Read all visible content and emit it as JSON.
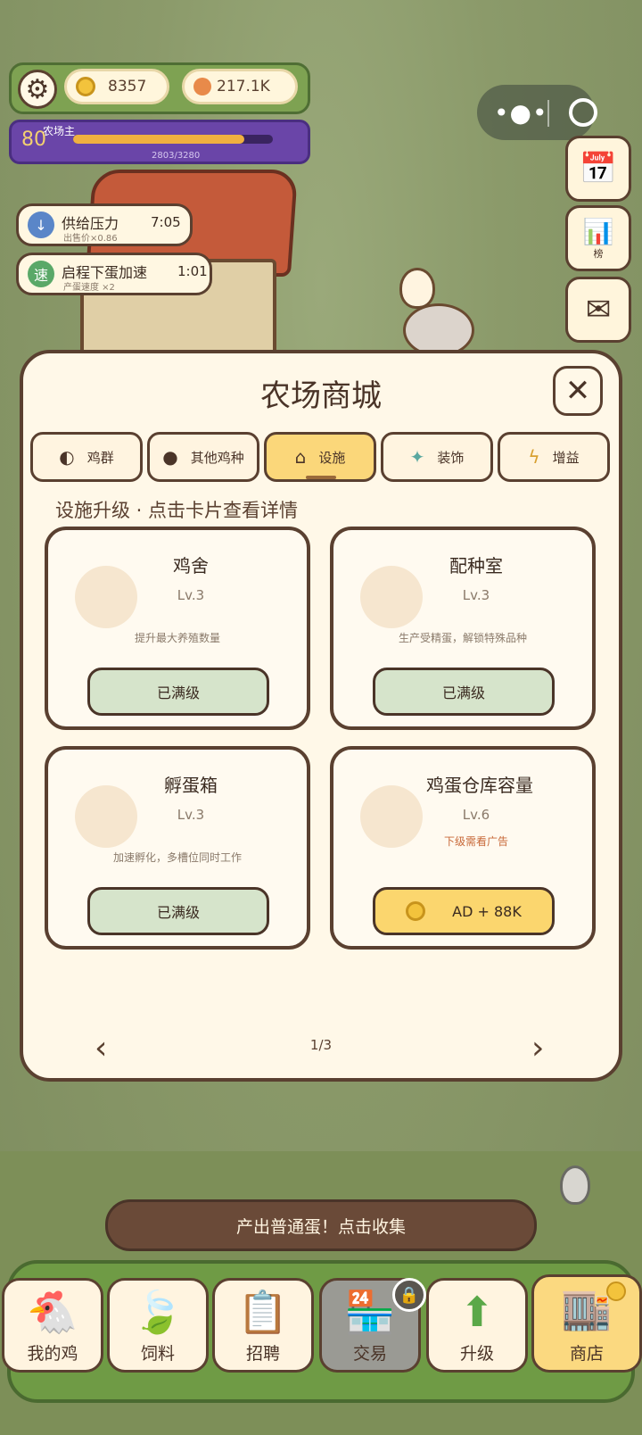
{
  "hud": {
    "coins": "8357",
    "gems": "217.1K",
    "level": "80",
    "level_title": "农场主",
    "xp_text": "2803/3280",
    "xp_fraction": 0.855
  },
  "side_buttons": {
    "rank_label": "榜"
  },
  "buffs": [
    {
      "icon": "↓",
      "name": "供给压力",
      "sub": "出售价×0.86",
      "time": "7:05",
      "color": "#5a86c8"
    },
    {
      "icon": "速",
      "name": "启程下蛋加速",
      "sub": "产蛋速度 ×2",
      "time": "1:01",
      "color": "#5aa868"
    }
  ],
  "shop": {
    "title": "农场商城",
    "close": "✕",
    "tabs": [
      {
        "icon": "◐",
        "label": "鸡群"
      },
      {
        "icon": "●",
        "label": "其他鸡种"
      },
      {
        "icon": "⌂",
        "label": "设施",
        "active": true
      },
      {
        "icon": "✦",
        "label": "装饰"
      },
      {
        "icon": "ϟ",
        "label": "增益"
      }
    ],
    "subtitle": "设施升级 · 点击卡片查看详情",
    "cards": [
      {
        "title": "鸡舍",
        "level": "Lv.3",
        "desc": "提升最大养殖数量",
        "button": "已满级"
      },
      {
        "title": "配种室",
        "level": "Lv.3",
        "desc": "生产受精蛋，解锁特殊品种",
        "button": "已满级"
      },
      {
        "title": "孵蛋箱",
        "level": "Lv.3",
        "desc": "加速孵化，多槽位同时工作",
        "button": "已满级"
      },
      {
        "title": "鸡蛋仓库容量",
        "level": "Lv.6",
        "warn": "下级需看广告",
        "button": "AD + 88K"
      }
    ],
    "page": "1/3",
    "prev": "‹",
    "next": "›"
  },
  "banner": "产出普通蛋！点击收集",
  "nav": [
    {
      "label": "我的鸡",
      "icon": "🐔"
    },
    {
      "label": "饲料",
      "icon": "🍃"
    },
    {
      "label": "招聘",
      "icon": "📋"
    },
    {
      "label": "交易",
      "icon": "🏪"
    },
    {
      "label": "升级",
      "icon": "⬆"
    },
    {
      "label": "商店",
      "icon": "🏬"
    }
  ]
}
